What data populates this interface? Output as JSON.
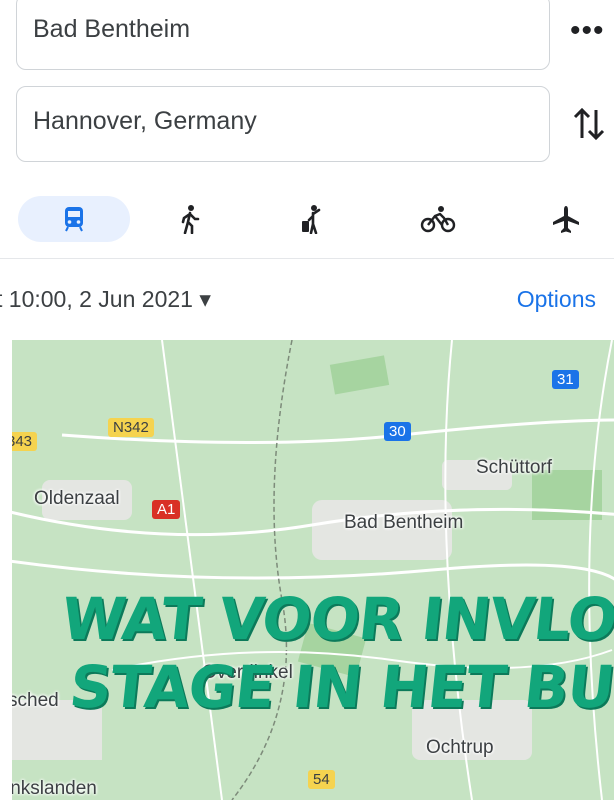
{
  "directions": {
    "origin": "Bad Bentheim",
    "destination": "Hannover, Germany"
  },
  "menu": {
    "more_label": "•••"
  },
  "modes": [
    {
      "name": "transit",
      "selected": true
    },
    {
      "name": "walk",
      "selected": false
    },
    {
      "name": "ride-hailing",
      "selected": false
    },
    {
      "name": "bike",
      "selected": false
    },
    {
      "name": "flight",
      "selected": false
    }
  ],
  "time": {
    "depart_text": "t 10:00, 2 Jun 2021 ▾",
    "options_label": "Options"
  },
  "map": {
    "road_labels": [
      "N342",
      "343",
      "30",
      "31",
      "A1",
      "54"
    ],
    "places": [
      "Oldenzaal",
      "Schüttorf",
      "Bad Bentheim",
      "Overdinkel",
      "Ochtrup",
      "sched",
      "inkslanden"
    ]
  },
  "overlay": {
    "line1": "WAT VOOR INVLOED HE",
    "line2": "STAGE IN HET BUITEN"
  },
  "colors": {
    "accent": "#1a73e8",
    "map_green": "#c6e3c3",
    "banner_green": "#12a67b"
  }
}
